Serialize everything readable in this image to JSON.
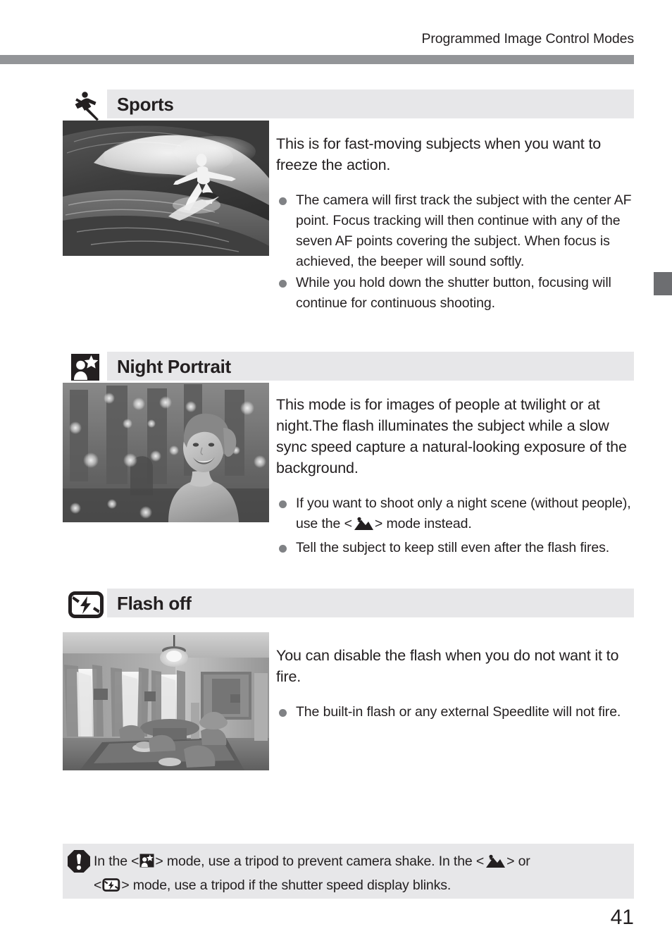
{
  "header": {
    "running_title": "Programmed Image Control Modes",
    "rule_color": "#939598"
  },
  "chapter_tab": {
    "name": "chapter-tab-marker",
    "color": "#6d6e71"
  },
  "sections": [
    {
      "id": "sports",
      "icon_name": "sports-running-figure-icon",
      "title": "Sports",
      "photo_name": "surfer-riding-wave-photo",
      "photo_alt": "Surfer riding a breaking wave, black and white",
      "lead": "This is for fast-moving subjects when you want to freeze the action.",
      "bullets": [
        "The camera will first track the subject with the center AF point. Focus tracking will then continue with any of the seven AF points covering the subject. When focus is achieved, the beeper will sound softly.",
        "While you hold down the shutter button, focusing will continue for continuous shooting."
      ]
    },
    {
      "id": "night-portrait",
      "icon_name": "night-portrait-person-star-icon",
      "title": "Night Portrait",
      "photo_name": "woman-at-night-with-bokeh-lights-photo",
      "photo_alt": "Smiling woman at night with blurred city lights behind, black and white",
      "lead": "This mode is for images of people at twilight or at night.The flash illuminates the subject while a slow sync speed capture a natural-looking exposure of the background.",
      "bullets": [
        {
          "before": "If you want to shoot only a night scene (without people), use the <",
          "glyph": "landscape-mountain-icon",
          "after": "> mode instead."
        },
        {
          "before": "Tell the subject to keep still even after the flash fires."
        }
      ]
    },
    {
      "id": "flash-off",
      "icon_name": "flash-off-icon",
      "title": "Flash off",
      "photo_name": "dining-room-interior-photo",
      "photo_alt": "Dining room interior with chandelier and curtained windows, black and white",
      "lead": "You can disable the flash when you do not want it to fire.",
      "bullets": [
        "The built-in flash or any external Speedlite will not fire."
      ]
    }
  ],
  "note": {
    "icon_name": "caution-exclamation-icon",
    "line1_part1": "In the <",
    "line1_glyph1": "night-portrait-person-star-icon",
    "line1_part2": "> mode,  use a tripod to prevent camera shake. In the  <",
    "line1_glyph2": "landscape-mountain-icon",
    "line1_part3": ">  or",
    "line2_part1": "<",
    "line2_glyph1": "flash-off-icon",
    "line2_part2": "> mode, use a tripod if the shutter speed display blinks."
  },
  "folio": {
    "page_number": "41"
  }
}
